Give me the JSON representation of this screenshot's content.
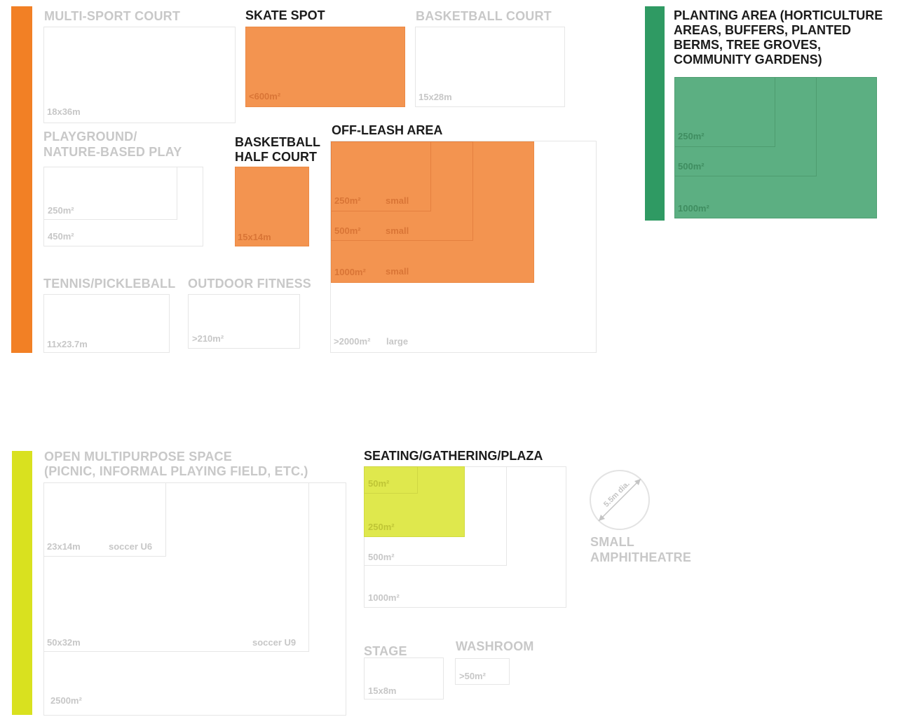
{
  "colors": {
    "orange": "#f39450",
    "orange_bar": "#f28025",
    "green": "#5caf82",
    "green_bar": "#2f9a63",
    "lime": "#dfe84d",
    "lime_bar": "#d9e11f",
    "outline_grey": "#e6e6e6",
    "label_grey": "#c8c8c8"
  },
  "multi_sport": {
    "title": "MULTI-SPORT COURT",
    "size": "18x36m"
  },
  "skate": {
    "title": "SKATE SPOT",
    "size": "<600m²"
  },
  "basketball": {
    "title": "BASKETBALL COURT",
    "size": "15x28m"
  },
  "playground": {
    "title_line1": "PLAYGROUND/",
    "title_line2": "NATURE-BASED PLAY",
    "size_small": "250m²",
    "size_large": "450m²"
  },
  "half_court": {
    "title_line1": "BASKETBALL",
    "title_line2": "HALF COURT",
    "size": "15x14m"
  },
  "off_leash": {
    "title": "OFF-LEASH AREA",
    "tiers": [
      {
        "area": "250m²",
        "type": "small"
      },
      {
        "area": "500m²",
        "type": "small"
      },
      {
        "area": "1000m²",
        "type": "small"
      },
      {
        "area": ">2000m²",
        "type": "large"
      }
    ]
  },
  "tennis": {
    "title": "TENNIS/PICKLEBALL",
    "size": "11x23.7m"
  },
  "fitness": {
    "title": "OUTDOOR FITNESS",
    "size": ">210m²"
  },
  "planting": {
    "title_line1": "PLANTING AREA (HORTICULTURE",
    "title_line2": "AREAS, BUFFERS, PLANTED",
    "title_line3": "BERMS, TREE GROVES,",
    "title_line4": "COMMUNITY GARDENS)",
    "tiers": [
      "250m²",
      "500m²",
      "1000m²"
    ]
  },
  "open_space": {
    "title_line1": "OPEN MULTIPURPOSE SPACE",
    "title_line2": "(PICNIC, INFORMAL PLAYING FIELD, ETC.)",
    "u6_size": "23x14m",
    "u6_label": "soccer U6",
    "u9_size": "50x32m",
    "u9_label": "soccer U9",
    "total": "2500m²"
  },
  "plaza": {
    "title": "SEATING/GATHERING/PLAZA",
    "tiers": [
      "50m²",
      "250m²",
      "500m²",
      "1000m²"
    ]
  },
  "amphitheatre": {
    "title_line1": "SMALL",
    "title_line2": "AMPHITHEATRE",
    "diameter": "5.5m dia."
  },
  "stage": {
    "title": "STAGE",
    "size": "15x8m"
  },
  "washroom": {
    "title": "WASHROOM",
    "size": ">50m²"
  }
}
